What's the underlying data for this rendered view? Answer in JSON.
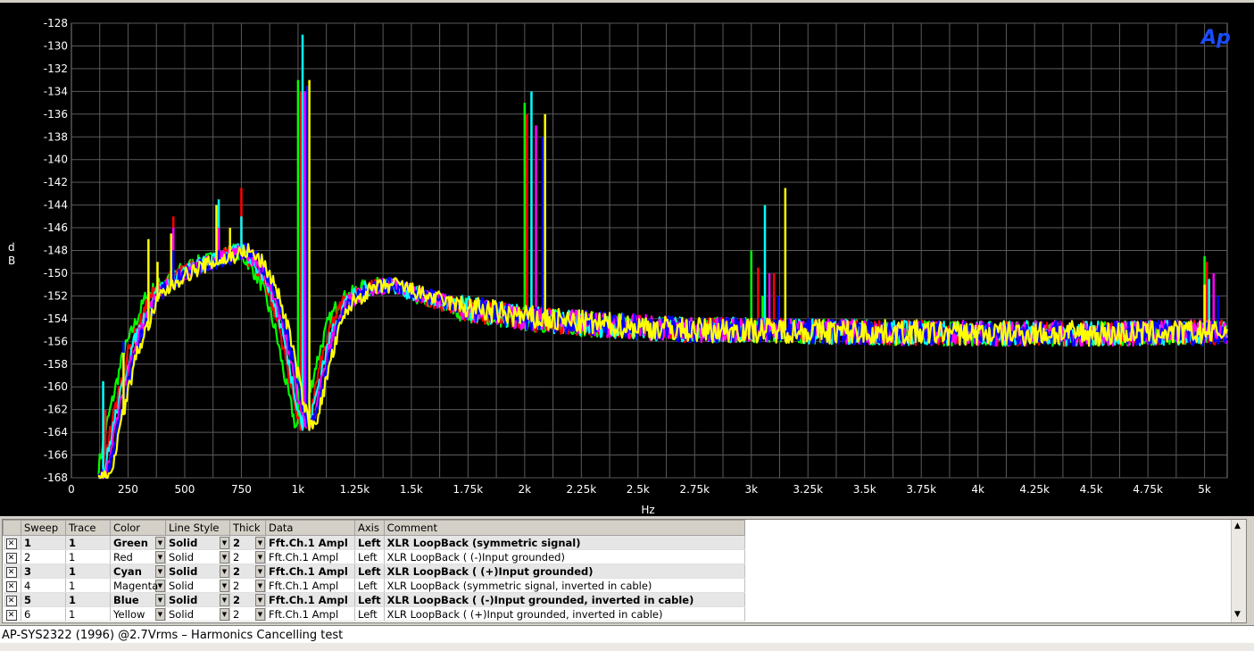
{
  "chart_data": {
    "type": "line",
    "logo": "Ap",
    "xlabel": "Hz",
    "ylabel": "d\nB",
    "xlim": [
      0,
      5100
    ],
    "ylim": [
      -168,
      -128
    ],
    "x_ticks": [
      {
        "value": 0,
        "label": "0"
      },
      {
        "value": 250,
        "label": "250"
      },
      {
        "value": 500,
        "label": "500"
      },
      {
        "value": 750,
        "label": "750"
      },
      {
        "value": 1000,
        "label": "1k"
      },
      {
        "value": 1250,
        "label": "1.25k"
      },
      {
        "value": 1500,
        "label": "1.5k"
      },
      {
        "value": 1750,
        "label": "1.75k"
      },
      {
        "value": 2000,
        "label": "2k"
      },
      {
        "value": 2250,
        "label": "2.25k"
      },
      {
        "value": 2500,
        "label": "2.5k"
      },
      {
        "value": 2750,
        "label": "2.75k"
      },
      {
        "value": 3000,
        "label": "3k"
      },
      {
        "value": 3250,
        "label": "3.25k"
      },
      {
        "value": 3500,
        "label": "3.5k"
      },
      {
        "value": 3750,
        "label": "3.75k"
      },
      {
        "value": 4000,
        "label": "4k"
      },
      {
        "value": 4250,
        "label": "4.25k"
      },
      {
        "value": 4500,
        "label": "4.5k"
      },
      {
        "value": 4750,
        "label": "4.75k"
      },
      {
        "value": 5000,
        "label": "5k"
      }
    ],
    "y_ticks": [
      -128,
      -130,
      -132,
      -134,
      -136,
      -138,
      -140,
      -142,
      -144,
      -146,
      -148,
      -150,
      -152,
      -154,
      -156,
      -158,
      -160,
      -162,
      -164,
      -166,
      -168
    ],
    "grid": true,
    "series": [
      {
        "name": "XLR LoopBack (symmetric signal)",
        "color": "#00ff00",
        "x_shift": -20,
        "peaks": [
          [
            150,
            -163
          ],
          [
            400,
            -152
          ],
          [
            450,
            -147
          ],
          [
            650,
            -146
          ],
          [
            750,
            -147
          ],
          [
            1000,
            -133
          ],
          [
            2000,
            -135
          ],
          [
            3000,
            -148
          ],
          [
            3050,
            -152
          ],
          [
            5000,
            -148.5
          ]
        ]
      },
      {
        "name": "XLR LoopBack ( (-)Input grounded)",
        "color": "#ff0000",
        "x_shift": 0,
        "peaks": [
          [
            150,
            -162
          ],
          [
            450,
            -145
          ],
          [
            650,
            -149
          ],
          [
            750,
            -142.5
          ],
          [
            1010,
            -134
          ],
          [
            2010,
            -136
          ],
          [
            3030,
            -149.5
          ],
          [
            3100,
            -150
          ],
          [
            5010,
            -149
          ]
        ]
      },
      {
        "name": "XLR LoopBack ( (+)Input grounded)",
        "color": "#00ffff",
        "x_shift": 10,
        "peaks": [
          [
            140,
            -159.5
          ],
          [
            450,
            -149
          ],
          [
            650,
            -143.5
          ],
          [
            750,
            -145
          ],
          [
            1020,
            -129
          ],
          [
            2030,
            -134
          ],
          [
            3060,
            -144
          ],
          [
            5020,
            -150.5
          ]
        ]
      },
      {
        "name": "XLR LoopBack (symmetric signal, inverted in cable)",
        "color": "#ff00ff",
        "x_shift": 20,
        "peaks": [
          [
            450,
            -146
          ],
          [
            650,
            -146
          ],
          [
            1030,
            -134
          ],
          [
            2050,
            -137
          ],
          [
            3080,
            -150
          ],
          [
            5040,
            -150
          ]
        ]
      },
      {
        "name": "XLR LoopBack ( (-)Input grounded, inverted in cable)",
        "color": "#0000ff",
        "x_shift": 30,
        "peaks": [
          [
            230,
            -156
          ],
          [
            450,
            -148
          ],
          [
            650,
            -148
          ],
          [
            1040,
            -133.5
          ],
          [
            2080,
            -138
          ],
          [
            3120,
            -152
          ],
          [
            5060,
            -152
          ]
        ]
      },
      {
        "name": "XLR LoopBack ( (+)Input grounded, inverted in cable)",
        "color": "#ffff00",
        "x_shift": 40,
        "peaks": [
          [
            150,
            -167.5
          ],
          [
            230,
            -157
          ],
          [
            340,
            -147
          ],
          [
            380,
            -149
          ],
          [
            440,
            -146.5
          ],
          [
            640,
            -144
          ],
          [
            700,
            -146
          ],
          [
            1050,
            -133
          ],
          [
            2090,
            -136
          ],
          [
            3150,
            -142.5
          ],
          [
            5000,
            -151
          ]
        ]
      }
    ]
  },
  "table": {
    "headers": [
      "",
      "Sweep",
      "Trace",
      "Color",
      "Line Style",
      "Thick",
      "Data",
      "Axis",
      "Comment"
    ],
    "rows": [
      {
        "check": "✕",
        "sweep": "1",
        "trace": "1",
        "color": "Green",
        "style": "Solid",
        "thick": "2",
        "data": "Fft.Ch.1 Ampl",
        "axis": "Left",
        "comment": "XLR LoopBack (symmetric signal)",
        "bold": true
      },
      {
        "check": "✕",
        "sweep": "2",
        "trace": "1",
        "color": "Red",
        "style": "Solid",
        "thick": "2",
        "data": "Fft.Ch.1 Ampl",
        "axis": "Left",
        "comment": "XLR LoopBack ( (-)Input grounded)",
        "bold": false
      },
      {
        "check": "✕",
        "sweep": "3",
        "trace": "1",
        "color": "Cyan",
        "style": "Solid",
        "thick": "2",
        "data": "Fft.Ch.1 Ampl",
        "axis": "Left",
        "comment": "XLR LoopBack ( (+)Input grounded)",
        "bold": true
      },
      {
        "check": "✕",
        "sweep": "4",
        "trace": "1",
        "color": "Magenta",
        "style": "Solid",
        "thick": "2",
        "data": "Fft.Ch.1 Ampl",
        "axis": "Left",
        "comment": "XLR LoopBack (symmetric signal, inverted in cable)",
        "bold": false
      },
      {
        "check": "✕",
        "sweep": "5",
        "trace": "1",
        "color": "Blue",
        "style": "Solid",
        "thick": "2",
        "data": "Fft.Ch.1 Ampl",
        "axis": "Left",
        "comment": "XLR LoopBack ( (-)Input grounded, inverted in cable)",
        "bold": true
      },
      {
        "check": "✕",
        "sweep": "6",
        "trace": "1",
        "color": "Yellow",
        "style": "Solid",
        "thick": "2",
        "data": "Fft.Ch.1 Ampl",
        "axis": "Left",
        "comment": "XLR LoopBack ( (+)Input grounded, inverted in cable)",
        "bold": false
      }
    ]
  },
  "status": {
    "text": "AP-SYS2322 (1996) @2.7Vrms  – Harmonics Cancelling test"
  },
  "icons": {
    "scroll_up": "scroll-up-arrow-icon",
    "scroll_down": "scroll-down-arrow-icon",
    "dropdown": "dropdown-arrow-icon",
    "checkbox": "checkbox-checked-icon"
  }
}
